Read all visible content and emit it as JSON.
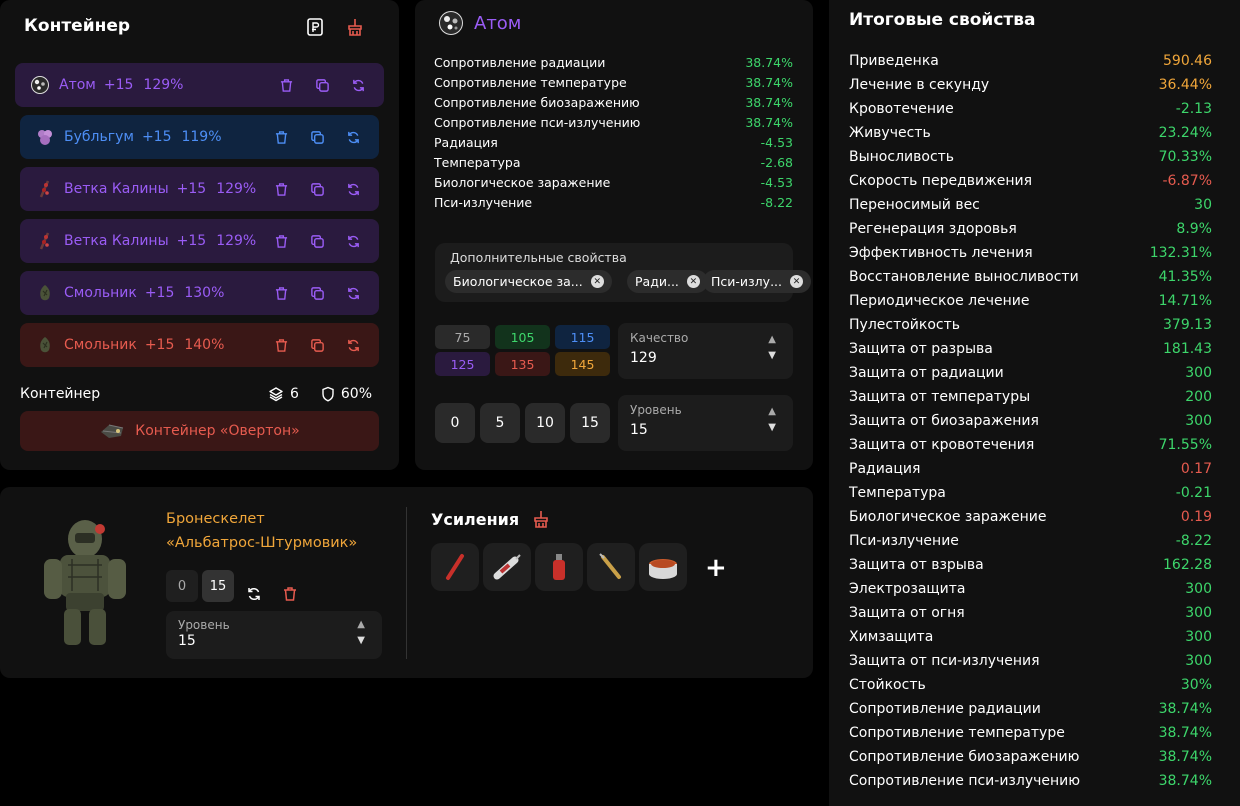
{
  "colors": {
    "purple": "#9a5cf5",
    "blue": "#4d8ef5",
    "red": "#e65b4f",
    "green": "#3dd66b",
    "orange": "#f0a63a"
  },
  "container": {
    "title": "Контейнер",
    "artifacts": [
      {
        "name": "Атом",
        "level": "+15",
        "percent": "129%",
        "color": "purple",
        "icon": "atom-artifact-icon"
      },
      {
        "name": "Бубльгум",
        "level": "+15",
        "percent": "119%",
        "color": "blue",
        "icon": "bubblegum-artifact-icon"
      },
      {
        "name": "Ветка Калины",
        "level": "+15",
        "percent": "129%",
        "color": "purple",
        "icon": "viburnum-branch-icon"
      },
      {
        "name": "Ветка Калины",
        "level": "+15",
        "percent": "129%",
        "color": "purple",
        "icon": "viburnum-branch-icon"
      },
      {
        "name": "Смольник",
        "level": "+15",
        "percent": "130%",
        "color": "purple",
        "icon": "resin-artifact-icon"
      },
      {
        "name": "Смольник",
        "level": "+15",
        "percent": "140%",
        "color": "red",
        "icon": "resin-artifact-icon"
      }
    ],
    "summary_label": "Контейнер",
    "slots": "6",
    "protection": "60%",
    "container_name": "Контейнер «Овертон»"
  },
  "atom": {
    "title": "Атом",
    "props": [
      {
        "label": "Сопротивление радиации",
        "value": "38.74%",
        "tone": "g"
      },
      {
        "label": "Сопротивление температуре",
        "value": "38.74%",
        "tone": "g"
      },
      {
        "label": "Сопротивление биозаражению",
        "value": "38.74%",
        "tone": "g"
      },
      {
        "label": "Сопротивление пси-излучению",
        "value": "38.74%",
        "tone": "g"
      },
      {
        "label": "Радиация",
        "value": "-4.53",
        "tone": "g"
      },
      {
        "label": "Температура",
        "value": "-2.68",
        "tone": "g"
      },
      {
        "label": "Биологическое заражение",
        "value": "-4.53",
        "tone": "g"
      },
      {
        "label": "Пси-излучение",
        "value": "-8.22",
        "tone": "g"
      }
    ],
    "extra_title": "Дополнительные свойства",
    "extra_chips": [
      "Биологическое за...",
      "Ради...",
      "Пси-излу..."
    ],
    "quality_buttons": [
      {
        "v": "75",
        "bg": "#2a2a2a",
        "fg": "#aaa"
      },
      {
        "v": "105",
        "bg": "#12331c",
        "fg": "#3dd66b"
      },
      {
        "v": "115",
        "bg": "#0f2440",
        "fg": "#4d8ef5"
      },
      {
        "v": "125",
        "bg": "#2a1a3e",
        "fg": "#9a5cf5"
      },
      {
        "v": "135",
        "bg": "#3a1716",
        "fg": "#e65b4f"
      },
      {
        "v": "145",
        "bg": "#3d2a0c",
        "fg": "#f0a63a"
      }
    ],
    "quality_label": "Качество",
    "quality_value": "129",
    "level_buttons": [
      "0",
      "5",
      "10",
      "15"
    ],
    "level_label": "Уровень",
    "level_value": "15"
  },
  "armor": {
    "name_line1": "Бронескелет",
    "name_line2": "«Альбатрос-Штурмовик»",
    "sharpen_buttons": [
      "0",
      "15"
    ],
    "level_label": "Уровень",
    "level_value": "15",
    "upgrades_title": "Усиления",
    "upgrades": [
      "red-stick-icon",
      "syringe-icon",
      "red-bottle-icon",
      "golden-syringe-icon",
      "stew-pot-icon"
    ]
  },
  "totals": {
    "title": "Итоговые свойства",
    "rows": [
      {
        "label": "Приведенка",
        "value": "590.46",
        "tone": "o"
      },
      {
        "label": "Лечение в секунду",
        "value": "36.44%",
        "tone": "o"
      },
      {
        "label": "Кровотечение",
        "value": "-2.13",
        "tone": "g"
      },
      {
        "label": "Живучесть",
        "value": "23.24%",
        "tone": "g"
      },
      {
        "label": "Выносливость",
        "value": "70.33%",
        "tone": "g"
      },
      {
        "label": "Скорость передвижения",
        "value": "-6.87%",
        "tone": "rr"
      },
      {
        "label": "Переносимый вес",
        "value": "30",
        "tone": "g"
      },
      {
        "label": "Регенерация здоровья",
        "value": "8.9%",
        "tone": "g"
      },
      {
        "label": "Эффективность лечения",
        "value": "132.31%",
        "tone": "g"
      },
      {
        "label": "Восстановление выносливости",
        "value": "41.35%",
        "tone": "g"
      },
      {
        "label": "Периодическое лечение",
        "value": "14.71%",
        "tone": "g"
      },
      {
        "label": "Пулестойкость",
        "value": "379.13",
        "tone": "g"
      },
      {
        "label": "Защита от разрыва",
        "value": "181.43",
        "tone": "g"
      },
      {
        "label": "Защита от радиации",
        "value": "300",
        "tone": "g"
      },
      {
        "label": "Защита от температуры",
        "value": "200",
        "tone": "g"
      },
      {
        "label": "Защита от биозаражения",
        "value": "300",
        "tone": "g"
      },
      {
        "label": "Защита от кровотечения",
        "value": "71.55%",
        "tone": "g"
      },
      {
        "label": "Радиация",
        "value": "0.17",
        "tone": "rr"
      },
      {
        "label": "Температура",
        "value": "-0.21",
        "tone": "g"
      },
      {
        "label": "Биологическое заражение",
        "value": "0.19",
        "tone": "rr"
      },
      {
        "label": "Пси-излучение",
        "value": "-8.22",
        "tone": "g"
      },
      {
        "label": "Защита от взрыва",
        "value": "162.28",
        "tone": "g"
      },
      {
        "label": "Электрозащита",
        "value": "300",
        "tone": "g"
      },
      {
        "label": "Защита от огня",
        "value": "300",
        "tone": "g"
      },
      {
        "label": "Химзащита",
        "value": "300",
        "tone": "g"
      },
      {
        "label": "Защита от пси-излучения",
        "value": "300",
        "tone": "g"
      },
      {
        "label": "Стойкость",
        "value": "30%",
        "tone": "g"
      },
      {
        "label": "Сопротивление радиации",
        "value": "38.74%",
        "tone": "g"
      },
      {
        "label": "Сопротивление температуре",
        "value": "38.74%",
        "tone": "g"
      },
      {
        "label": "Сопротивление биозаражению",
        "value": "38.74%",
        "tone": "g"
      },
      {
        "label": "Сопротивление пси-излучению",
        "value": "38.74%",
        "tone": "g"
      }
    ]
  }
}
